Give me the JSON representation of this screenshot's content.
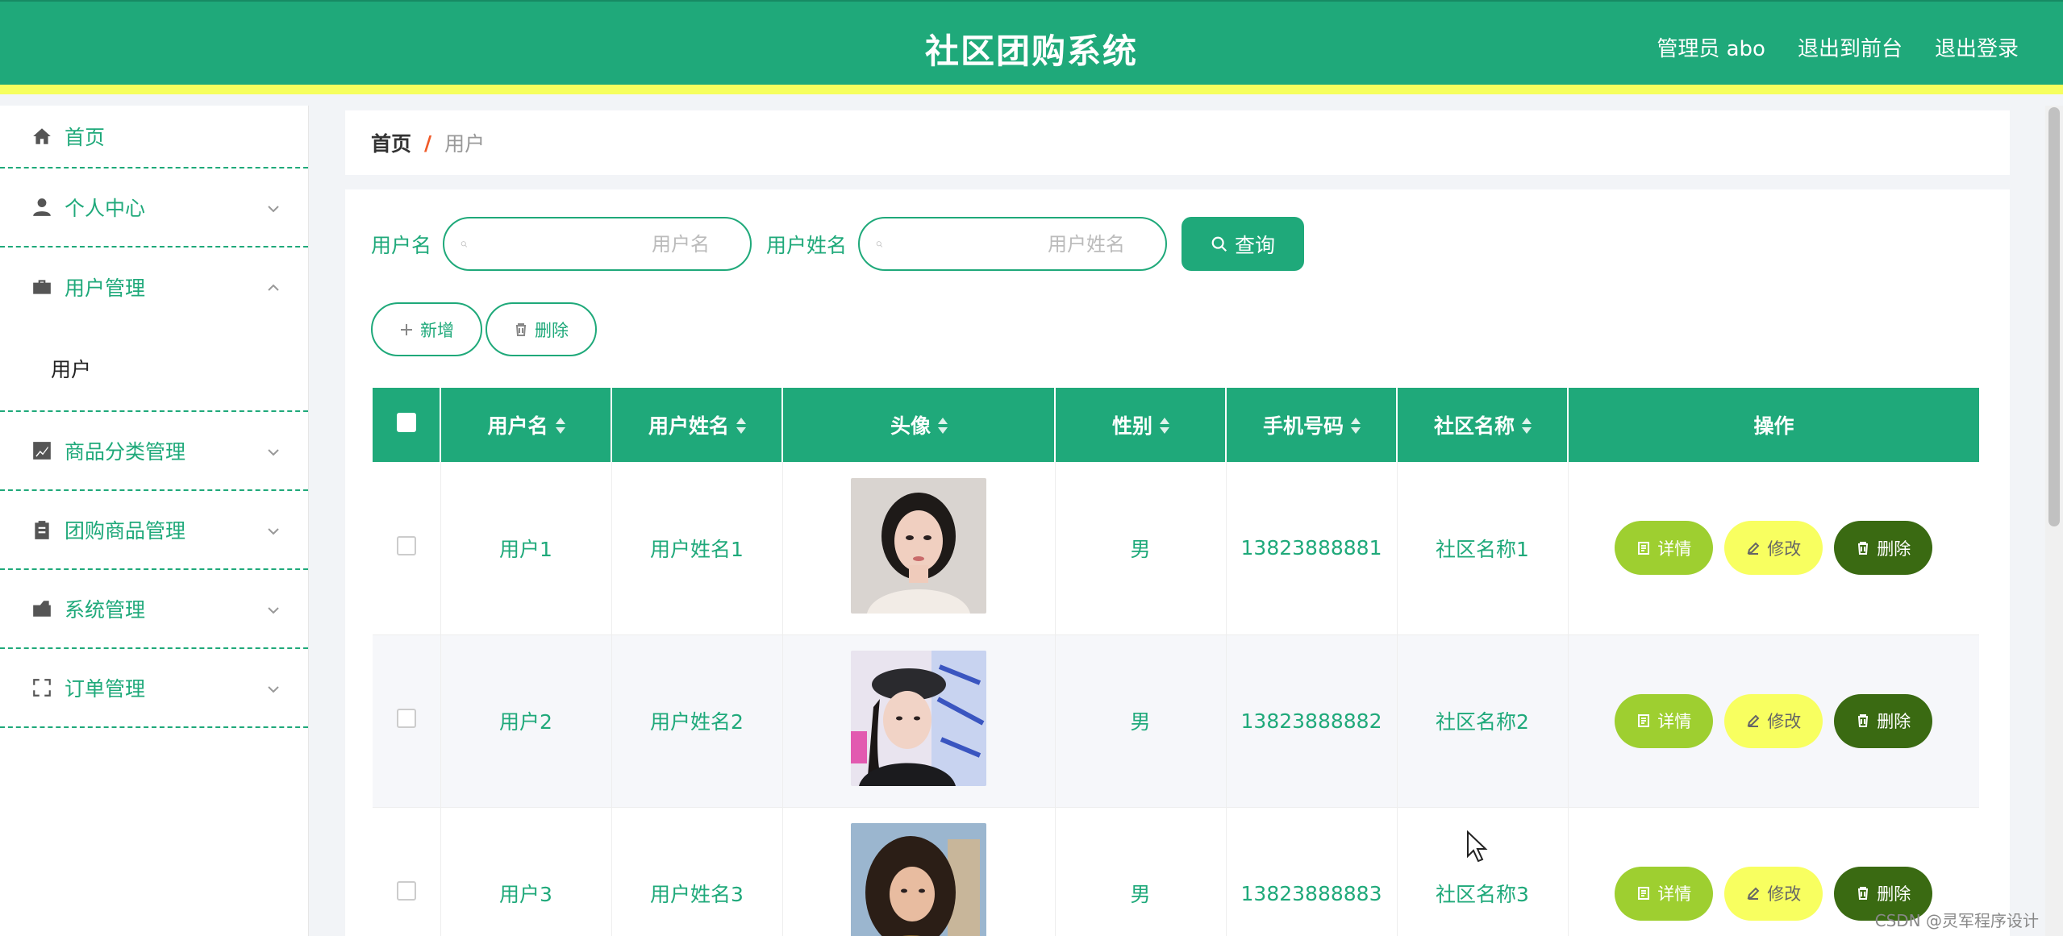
{
  "header": {
    "title": "社区团购系统",
    "admin": "管理员 abo",
    "to_front": "退出到前台",
    "logout": "退出登录"
  },
  "sidebar": {
    "items": [
      {
        "label": "首页",
        "icon": "home-icon"
      },
      {
        "label": "个人中心",
        "icon": "user-icon"
      },
      {
        "label": "用户管理",
        "icon": "briefcase-icon",
        "sub": "用户"
      },
      {
        "label": "商品分类管理",
        "icon": "chart-icon"
      },
      {
        "label": "团购商品管理",
        "icon": "clipboard-icon"
      },
      {
        "label": "系统管理",
        "icon": "wallet-icon"
      },
      {
        "label": "订单管理",
        "icon": "expand-icon"
      }
    ]
  },
  "breadcrumb": {
    "home": "首页",
    "sep": "/",
    "current": "用户"
  },
  "search": {
    "username_label": "用户名",
    "username_placeholder": "用户名",
    "realname_label": "用户姓名",
    "realname_placeholder": "用户姓名",
    "query_label": "查询"
  },
  "actions": {
    "add": "新增",
    "delete": "删除"
  },
  "table": {
    "headers": [
      "用户名",
      "用户姓名",
      "头像",
      "性别",
      "手机号码",
      "社区名称",
      "操作"
    ],
    "rows": [
      {
        "username": "用户1",
        "realname": "用户姓名1",
        "gender": "男",
        "phone": "13823888881",
        "community": "社区名称1"
      },
      {
        "username": "用户2",
        "realname": "用户姓名2",
        "gender": "男",
        "phone": "13823888882",
        "community": "社区名称2"
      },
      {
        "username": "用户3",
        "realname": "用户姓名3",
        "gender": "男",
        "phone": "13823888883",
        "community": "社区名称3"
      }
    ],
    "op_detail": "详情",
    "op_edit": "修改",
    "op_delete": "删除"
  },
  "watermark": "CSDN @灵军程序设计",
  "colors": {
    "primary": "#1fa97a",
    "accent_yellow": "#f6ff5e",
    "detail": "#9ecf30",
    "edit": "#f8ff60",
    "delete": "#3a6a12"
  }
}
